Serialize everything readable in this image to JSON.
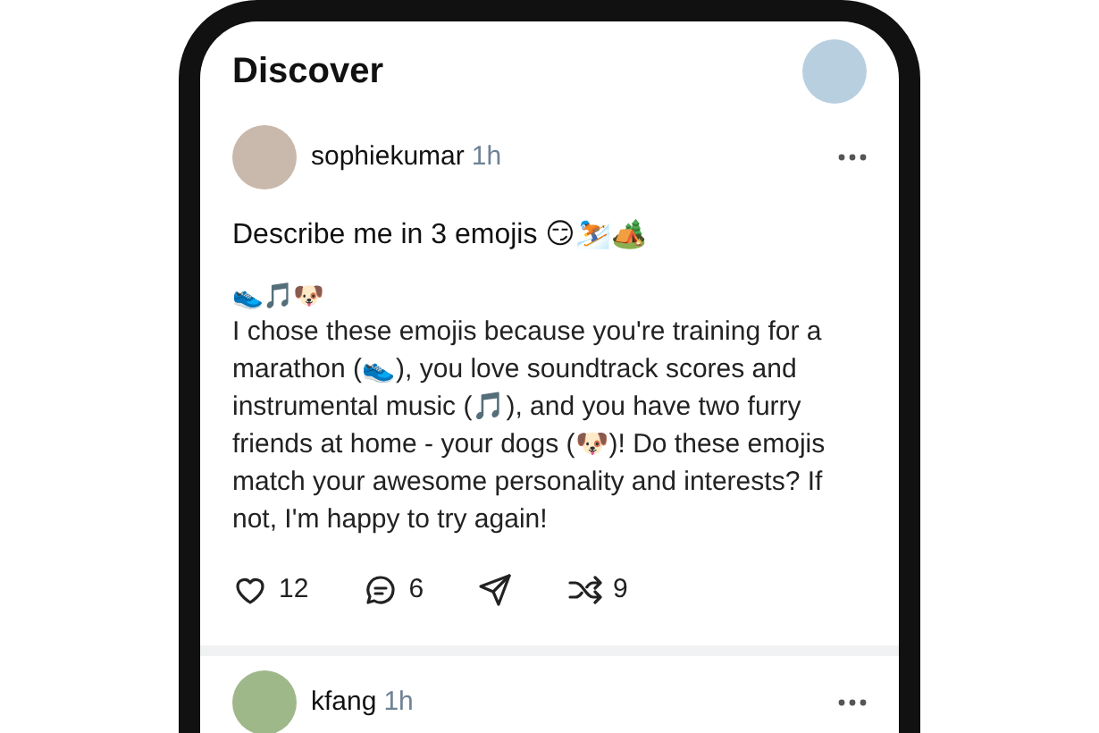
{
  "header": {
    "title": "Discover"
  },
  "posts": [
    {
      "username": "sophiekumar",
      "time": "1h",
      "prompt": "Describe me in 3 emojis 😏⛷️🏕️",
      "reply_emojis": "👟🎵🐶",
      "reply": "I chose these emojis because you're training for a marathon (👟), you love soundtrack scores and instrumental music (🎵), and you have two furry friends at home - your dogs (🐶)! Do these emojis match your awesome personality and interests? If not, I'm happy to try again!",
      "actions": [
        {
          "kind": "like",
          "count": "12"
        },
        {
          "kind": "comment",
          "count": "6"
        },
        {
          "kind": "share"
        },
        {
          "kind": "repost",
          "count": "9"
        }
      ]
    },
    {
      "username": "kfang",
      "time": "1h"
    }
  ]
}
